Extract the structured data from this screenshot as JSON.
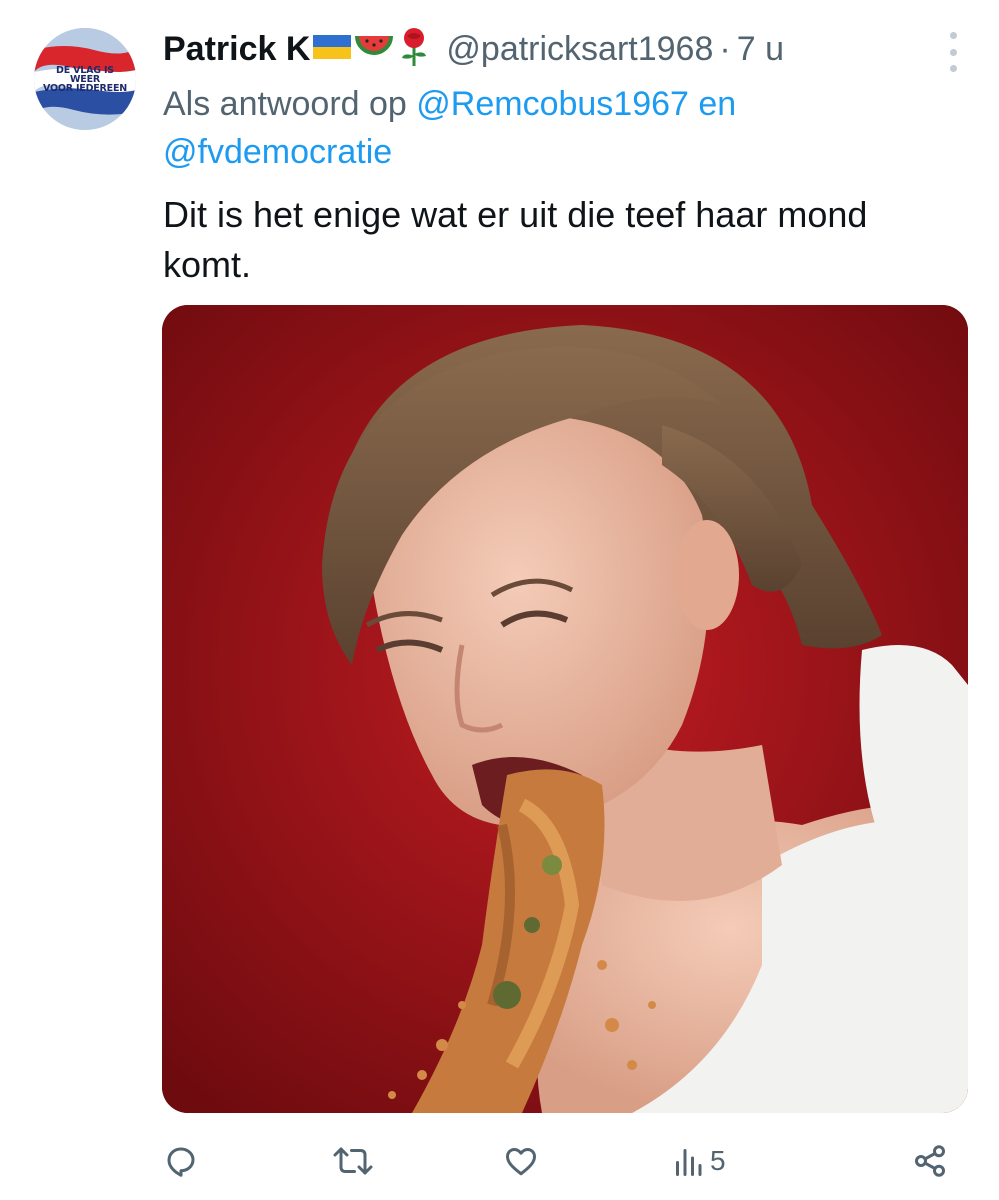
{
  "author": {
    "display_name": "Patrick K",
    "handle": "@patricksart1968",
    "separator": "·",
    "time": "7 u",
    "emojis": [
      "ukraine-flag",
      "watermelon",
      "rose"
    ],
    "avatar_text": [
      "DE VLAG IS",
      "WEER",
      "VOOR IEDEREEN"
    ]
  },
  "reply": {
    "prefix": "Als antwoord op",
    "mention_1": "@Remcobus1967",
    "conjunction": "en",
    "mention_2": "@fvdemocratie"
  },
  "tweet": {
    "text": "Dit is het enige wat er uit die teef haar mond komt."
  },
  "media": {
    "subject": "photo-woman-vomiting",
    "background_color": "#a0141a"
  },
  "actions": {
    "reply_icon": "reply-icon",
    "retweet_icon": "retweet-icon",
    "like_icon": "heart-icon",
    "views_icon": "analytics-icon",
    "views_count": "5",
    "share_icon": "share-icon"
  },
  "colors": {
    "accent": "#1d9bf0",
    "secondary_text": "#536471",
    "primary_text": "#0f1419"
  }
}
